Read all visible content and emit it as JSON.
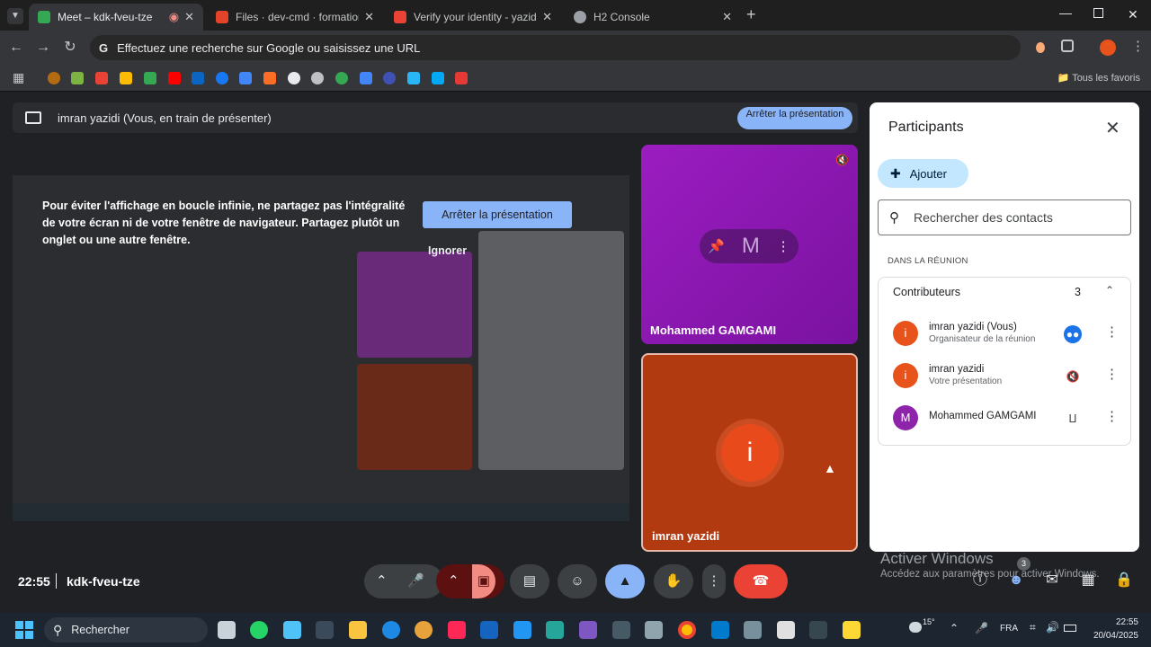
{
  "browser": {
    "tabs": [
      {
        "label": "Meet – kdk-fveu-tze",
        "active": true,
        "favicon_color": "#34a853"
      },
      {
        "label": "Files · dev-cmd · formations / m",
        "active": false,
        "favicon_color": "#e24329"
      },
      {
        "label": "Verify your identity - yazidi.imra",
        "active": false,
        "favicon_color": "#ea4335"
      },
      {
        "label": "H2 Console",
        "active": false,
        "favicon_color": "#9aa0a6"
      }
    ],
    "address_placeholder": "Effectuez une recherche sur Google ou saisissez une URL",
    "all_bookmarks": "Tous les favoris"
  },
  "meet": {
    "presenting_banner": "imran yazidi (Vous, en train de présenter)",
    "stop_presenting_top": "Arrêter la présentation",
    "loop_warning": "Pour éviter l'affichage en boucle infinie, ne partagez pas l'intégralité de votre écran ni de votre fenêtre de navigateur. Partagez plutôt un onglet ou une autre fenêtre.",
    "stop_presenting_button": "Arrêter la présentation",
    "ignore_button": "Ignorer",
    "tiles": [
      {
        "name": "Mohammed GAMGAMI",
        "initial": "M"
      },
      {
        "name": "imran yazidi",
        "initial": "i"
      }
    ],
    "time": "22:55",
    "meeting_code": "kdk-fveu-tze",
    "people_badge": "3"
  },
  "participants_panel": {
    "title": "Participants",
    "add_label": "Ajouter",
    "search_placeholder": "Rechercher des contacts",
    "in_meeting_label": "DANS LA RÉUNION",
    "group_label": "Contributeurs",
    "group_count": "3",
    "people": [
      {
        "initial": "i",
        "name": "imran yazidi (Vous)",
        "subtitle": "Organisateur de la réunion",
        "color": "#e8531c"
      },
      {
        "initial": "i",
        "name": "imran yazidi",
        "subtitle": "Votre présentation",
        "color": "#e8531c"
      },
      {
        "initial": "M",
        "name": "Mohammed GAMGAMI",
        "subtitle": "",
        "color": "#8e24aa"
      }
    ]
  },
  "watermark": {
    "title": "Activer Windows",
    "subtitle": "Accédez aux paramètres pour activer Windows."
  },
  "taskbar": {
    "search_label": "Rechercher",
    "language": "FRA",
    "time": "22:55",
    "date": "20/04/2025",
    "temperature": "15°"
  }
}
